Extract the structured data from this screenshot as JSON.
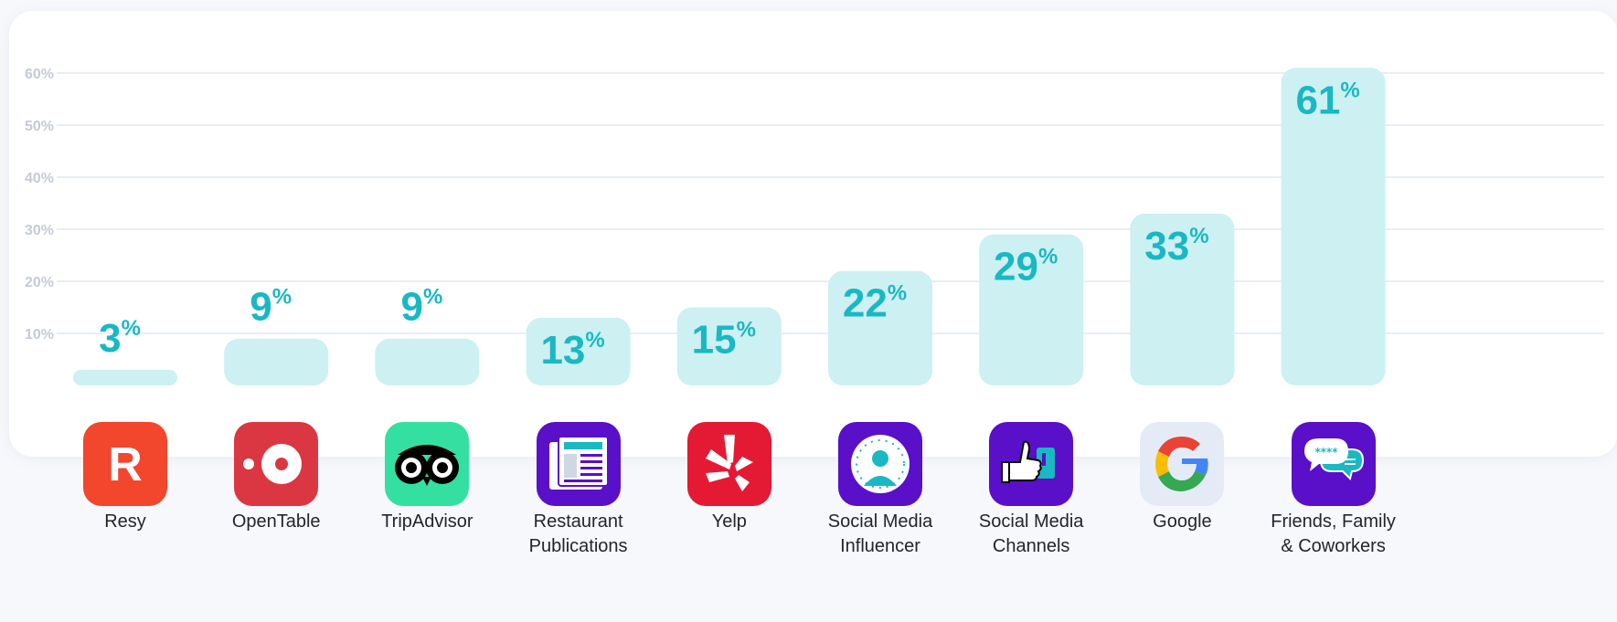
{
  "chart_data": {
    "type": "bar",
    "categories": [
      "Resy",
      "OpenTable",
      "TripAdvisor",
      "Restaurant Publications",
      "Yelp",
      "Social Media Influencer",
      "Social Media Channels",
      "Google",
      "Friends, Family & Coworkers"
    ],
    "category_label_lines": [
      [
        "Resy"
      ],
      [
        "OpenTable"
      ],
      [
        "TripAdvisor"
      ],
      [
        "Restaurant",
        "Publications"
      ],
      [
        "Yelp"
      ],
      [
        "Social Media",
        "Influencer"
      ],
      [
        "Social Media",
        "Channels"
      ],
      [
        "Google"
      ],
      [
        "Friends, Family",
        "& Coworkers"
      ]
    ],
    "values": [
      3,
      9,
      9,
      13,
      15,
      22,
      29,
      33,
      61
    ],
    "value_number_labels": [
      "3",
      "9",
      "9",
      "13",
      "15",
      "22",
      "29",
      "33",
      "61"
    ],
    "value_suffix": "%",
    "ylim": [
      0,
      62
    ],
    "yticks": [
      10,
      20,
      30,
      40,
      50,
      60
    ],
    "ytick_labels": [
      "10%",
      "20%",
      "30%",
      "40%",
      "50%",
      "60%"
    ],
    "grid": true,
    "legend": false,
    "colors": {
      "bar": "#cdf0f2",
      "value_text": "#19b8c3",
      "grid": "#e9eef5",
      "tick_text": "#c5cbd6"
    }
  },
  "icons": [
    {
      "name": "resy-icon",
      "bg": "#f2462d",
      "glyph": "R"
    },
    {
      "name": "opentable-icon",
      "bg": "#da3743"
    },
    {
      "name": "tripadvisor-icon",
      "bg": "#34e0a1"
    },
    {
      "name": "newspaper-icon",
      "bg": "#5a0fc8"
    },
    {
      "name": "yelp-icon",
      "bg": "#e41a34"
    },
    {
      "name": "influencer-icon",
      "bg": "#5a0fc8"
    },
    {
      "name": "thumbs-up-phone-icon",
      "bg": "#5a0fc8"
    },
    {
      "name": "google-icon",
      "bg": "#e4ebf7"
    },
    {
      "name": "chat-bubbles-icon",
      "bg": "#5a0fc8"
    }
  ]
}
